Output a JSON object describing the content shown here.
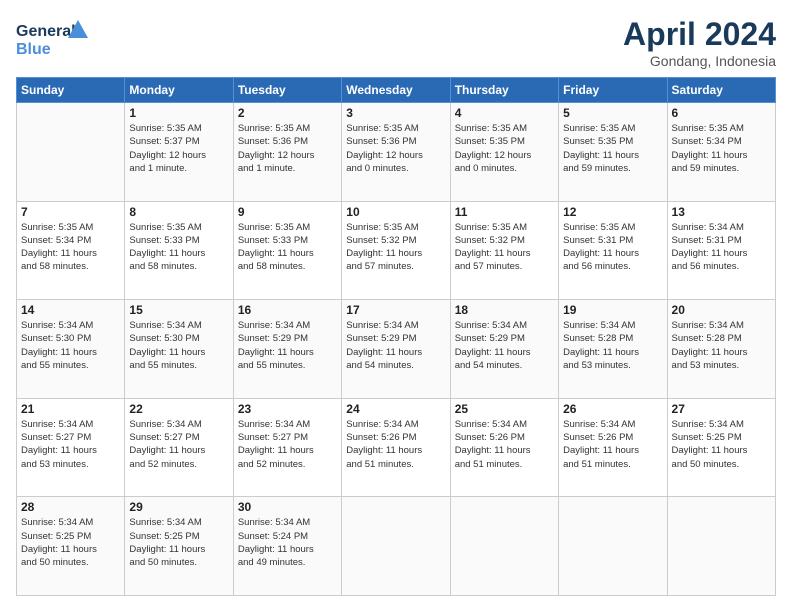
{
  "header": {
    "logo": {
      "general": "General",
      "blue": "Blue"
    },
    "title": "April 2024",
    "location": "Gondang, Indonesia"
  },
  "weekdays": [
    "Sunday",
    "Monday",
    "Tuesday",
    "Wednesday",
    "Thursday",
    "Friday",
    "Saturday"
  ],
  "weeks": [
    [
      {
        "day": "",
        "info": ""
      },
      {
        "day": "1",
        "info": "Sunrise: 5:35 AM\nSunset: 5:37 PM\nDaylight: 12 hours\nand 1 minute."
      },
      {
        "day": "2",
        "info": "Sunrise: 5:35 AM\nSunset: 5:36 PM\nDaylight: 12 hours\nand 1 minute."
      },
      {
        "day": "3",
        "info": "Sunrise: 5:35 AM\nSunset: 5:36 PM\nDaylight: 12 hours\nand 0 minutes."
      },
      {
        "day": "4",
        "info": "Sunrise: 5:35 AM\nSunset: 5:35 PM\nDaylight: 12 hours\nand 0 minutes."
      },
      {
        "day": "5",
        "info": "Sunrise: 5:35 AM\nSunset: 5:35 PM\nDaylight: 11 hours\nand 59 minutes."
      },
      {
        "day": "6",
        "info": "Sunrise: 5:35 AM\nSunset: 5:34 PM\nDaylight: 11 hours\nand 59 minutes."
      }
    ],
    [
      {
        "day": "7",
        "info": "Sunrise: 5:35 AM\nSunset: 5:34 PM\nDaylight: 11 hours\nand 58 minutes."
      },
      {
        "day": "8",
        "info": "Sunrise: 5:35 AM\nSunset: 5:33 PM\nDaylight: 11 hours\nand 58 minutes."
      },
      {
        "day": "9",
        "info": "Sunrise: 5:35 AM\nSunset: 5:33 PM\nDaylight: 11 hours\nand 58 minutes."
      },
      {
        "day": "10",
        "info": "Sunrise: 5:35 AM\nSunset: 5:32 PM\nDaylight: 11 hours\nand 57 minutes."
      },
      {
        "day": "11",
        "info": "Sunrise: 5:35 AM\nSunset: 5:32 PM\nDaylight: 11 hours\nand 57 minutes."
      },
      {
        "day": "12",
        "info": "Sunrise: 5:35 AM\nSunset: 5:31 PM\nDaylight: 11 hours\nand 56 minutes."
      },
      {
        "day": "13",
        "info": "Sunrise: 5:34 AM\nSunset: 5:31 PM\nDaylight: 11 hours\nand 56 minutes."
      }
    ],
    [
      {
        "day": "14",
        "info": "Sunrise: 5:34 AM\nSunset: 5:30 PM\nDaylight: 11 hours\nand 55 minutes."
      },
      {
        "day": "15",
        "info": "Sunrise: 5:34 AM\nSunset: 5:30 PM\nDaylight: 11 hours\nand 55 minutes."
      },
      {
        "day": "16",
        "info": "Sunrise: 5:34 AM\nSunset: 5:29 PM\nDaylight: 11 hours\nand 55 minutes."
      },
      {
        "day": "17",
        "info": "Sunrise: 5:34 AM\nSunset: 5:29 PM\nDaylight: 11 hours\nand 54 minutes."
      },
      {
        "day": "18",
        "info": "Sunrise: 5:34 AM\nSunset: 5:29 PM\nDaylight: 11 hours\nand 54 minutes."
      },
      {
        "day": "19",
        "info": "Sunrise: 5:34 AM\nSunset: 5:28 PM\nDaylight: 11 hours\nand 53 minutes."
      },
      {
        "day": "20",
        "info": "Sunrise: 5:34 AM\nSunset: 5:28 PM\nDaylight: 11 hours\nand 53 minutes."
      }
    ],
    [
      {
        "day": "21",
        "info": "Sunrise: 5:34 AM\nSunset: 5:27 PM\nDaylight: 11 hours\nand 53 minutes."
      },
      {
        "day": "22",
        "info": "Sunrise: 5:34 AM\nSunset: 5:27 PM\nDaylight: 11 hours\nand 52 minutes."
      },
      {
        "day": "23",
        "info": "Sunrise: 5:34 AM\nSunset: 5:27 PM\nDaylight: 11 hours\nand 52 minutes."
      },
      {
        "day": "24",
        "info": "Sunrise: 5:34 AM\nSunset: 5:26 PM\nDaylight: 11 hours\nand 51 minutes."
      },
      {
        "day": "25",
        "info": "Sunrise: 5:34 AM\nSunset: 5:26 PM\nDaylight: 11 hours\nand 51 minutes."
      },
      {
        "day": "26",
        "info": "Sunrise: 5:34 AM\nSunset: 5:26 PM\nDaylight: 11 hours\nand 51 minutes."
      },
      {
        "day": "27",
        "info": "Sunrise: 5:34 AM\nSunset: 5:25 PM\nDaylight: 11 hours\nand 50 minutes."
      }
    ],
    [
      {
        "day": "28",
        "info": "Sunrise: 5:34 AM\nSunset: 5:25 PM\nDaylight: 11 hours\nand 50 minutes."
      },
      {
        "day": "29",
        "info": "Sunrise: 5:34 AM\nSunset: 5:25 PM\nDaylight: 11 hours\nand 50 minutes."
      },
      {
        "day": "30",
        "info": "Sunrise: 5:34 AM\nSunset: 5:24 PM\nDaylight: 11 hours\nand 49 minutes."
      },
      {
        "day": "",
        "info": ""
      },
      {
        "day": "",
        "info": ""
      },
      {
        "day": "",
        "info": ""
      },
      {
        "day": "",
        "info": ""
      }
    ]
  ]
}
